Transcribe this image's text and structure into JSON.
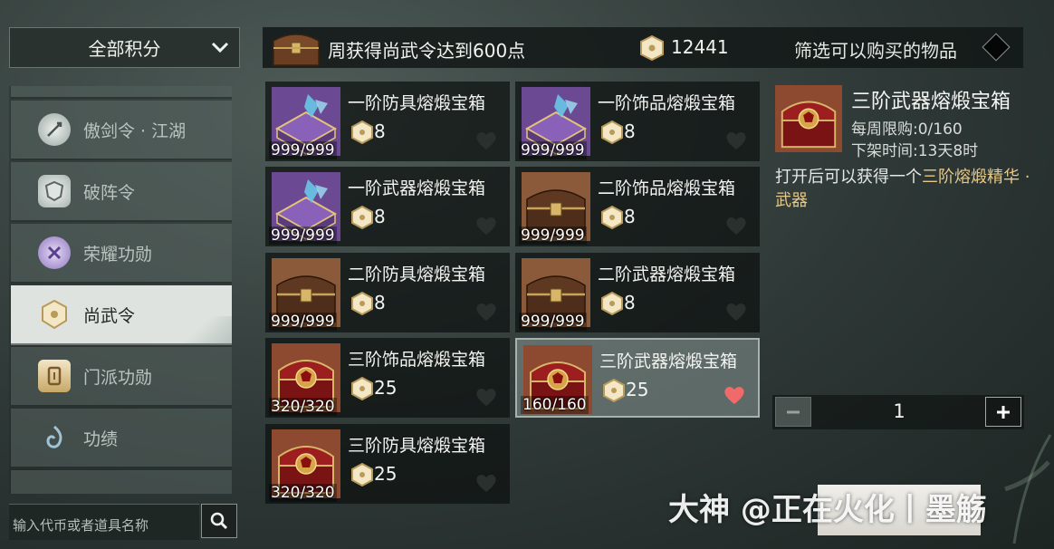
{
  "dropdown": {
    "label": "全部积分"
  },
  "categories": [
    {
      "label": "傲剑令 · 江湖",
      "icon": "sword-token-icon"
    },
    {
      "label": "破阵令",
      "icon": "shield-token-icon"
    },
    {
      "label": "荣耀功勋",
      "icon": "honor-medal-icon"
    },
    {
      "label": "尚武令",
      "icon": "shangwu-token-icon",
      "active": true
    },
    {
      "label": "门派功勋",
      "icon": "sect-medal-icon"
    },
    {
      "label": "功绩",
      "icon": "merit-icon"
    }
  ],
  "search": {
    "placeholder": "输入代币或者道具名称"
  },
  "topbar": {
    "title": "周获得尚武令达到600点",
    "currency_icon": "shangwu-token-icon",
    "balance": "12441",
    "filter_label": "筛选可以购买的物品"
  },
  "items": [
    {
      "name": "一阶防具熔煅宝箱",
      "price": "8",
      "stock": "999/999",
      "tier": "purple"
    },
    {
      "name": "一阶饰品熔煅宝箱",
      "price": "8",
      "stock": "999/999",
      "tier": "purple"
    },
    {
      "name": "一阶武器熔煅宝箱",
      "price": "8",
      "stock": "999/999",
      "tier": "purple"
    },
    {
      "name": "二阶饰品熔煅宝箱",
      "price": "8",
      "stock": "999/999",
      "tier": "brown"
    },
    {
      "name": "二阶防具熔煅宝箱",
      "price": "8",
      "stock": "999/999",
      "tier": "brown"
    },
    {
      "name": "二阶武器熔煅宝箱",
      "price": "8",
      "stock": "999/999",
      "tier": "brown"
    },
    {
      "name": "三阶饰品熔煅宝箱",
      "price": "25",
      "stock": "320/320",
      "tier": "red"
    },
    {
      "name": "三阶武器熔煅宝箱",
      "price": "25",
      "stock": "160/160",
      "tier": "red",
      "selected": true,
      "favorited": true
    },
    {
      "name": "三阶防具熔煅宝箱",
      "price": "25",
      "stock": "320/320",
      "tier": "red"
    }
  ],
  "detail": {
    "name": "三阶武器熔煅宝箱",
    "weekly_limit": "每周限购:0/160",
    "delist_time": "下架时间:13天8时",
    "desc_prefix": "打开后可以获得一个",
    "desc_highlight": "三阶熔煅精华 · 武器"
  },
  "quantity": {
    "value": "1",
    "minus": "−",
    "plus": "+"
  },
  "watermark": "大神 @正在火化丨墨觞",
  "colors": {
    "highlight": "#e7c886",
    "heart_active": "#f06a6a",
    "heart_inactive": "#2a302e",
    "panel_dark": "#121716"
  }
}
